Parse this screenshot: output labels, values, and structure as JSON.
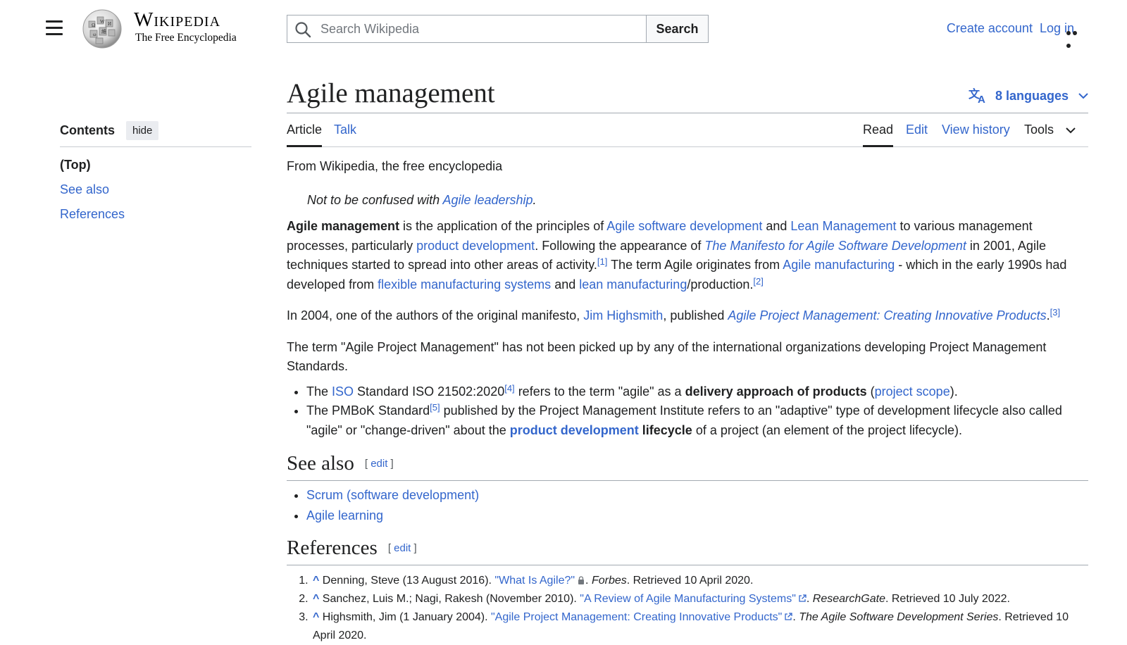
{
  "header": {
    "wordmark": "Wikipedia",
    "tagline": "The Free Encyclopedia",
    "search_placeholder": "Search Wikipedia",
    "search_button": "Search",
    "create_account": "Create account",
    "log_in": "Log in"
  },
  "toc": {
    "title": "Contents",
    "hide": "hide",
    "items": [
      "(Top)",
      "See also",
      "References"
    ]
  },
  "page": {
    "title": "Agile management",
    "languages": "8 languages",
    "tabs": {
      "article": "Article",
      "talk": "Talk",
      "read": "Read",
      "edit": "Edit",
      "view_history": "View history",
      "tools": "Tools"
    },
    "from": "From Wikipedia, the free encyclopedia",
    "hatnote": {
      "prefix": "Not to be confused with ",
      "link": "Agile leadership",
      "suffix": "."
    }
  },
  "body": {
    "p1": {
      "b1": "Agile management",
      "t1": " is the application of the principles of ",
      "l1": "Agile software development",
      "t2": " and ",
      "l2": "Lean Management",
      "t3": " to various management processes, particularly ",
      "l3": "product development",
      "t4": ". Following the appearance of ",
      "l4": "The Manifesto for Agile Software Development",
      "t5": " in 2001, Agile techniques started to spread into other areas of activity.",
      "r1": "[1]",
      "t6": " The term Agile originates from ",
      "l5": "Agile manufacturing",
      "t7": " - which in the early 1990s had developed from ",
      "l6": "flexible manufacturing systems",
      "t8": " and ",
      "l7": "lean manufacturing",
      "t9": "/production.",
      "r2": "[2]"
    },
    "p2": {
      "t1": "In 2004, one of the authors of the original manifesto, ",
      "l1": "Jim Highsmith",
      "t2": ", published ",
      "l2": "Agile Project Management: Creating Innovative Products",
      "t3": ".",
      "r3": "[3]"
    },
    "p3": "The term \"Agile Project Management\" has not been picked up by any of the international organizations developing Project Management Standards.",
    "li1": {
      "t1": "The ",
      "l1": "ISO",
      "t2": " Standard ISO 21502:2020",
      "r4": "[4]",
      "t3": " refers to the term \"agile\" as a ",
      "b1": "delivery approach of products",
      "t4": " (",
      "l2": "project scope",
      "t5": ")."
    },
    "li2": {
      "t1": "The PMBoK Standard",
      "r5": "[5]",
      "t2": " published by the Project Management Institute refers to an \"adaptive\" type of development lifecycle also called \"agile\" or \"change-driven\" about the ",
      "l1": "product development",
      "b1": " lifecycle",
      "t3": " of a project (an element of the project lifecycle)."
    }
  },
  "see_also": {
    "heading": "See also",
    "edit": "edit",
    "items": [
      "Scrum (software development)",
      "Agile learning"
    ]
  },
  "references": {
    "heading": "References",
    "edit": "edit",
    "caret": "^",
    "items": [
      {
        "pre": "Denning, Steve (13 August 2016). ",
        "link": "\"What Is Agile?\"",
        "pub": "Forbes",
        "post": ". Retrieved 10 April 2020."
      },
      {
        "pre": "Sanchez, Luis M.; Nagi, Rakesh (November 2010). ",
        "link": "\"A Review of Agile Manufacturing Systems\"",
        "pub": "ResearchGate",
        "post": ". Retrieved 10 July 2022."
      },
      {
        "pre": "Highsmith, Jim (1 January 2004). ",
        "link": "\"Agile Project Management: Creating Innovative Products\"",
        "pub": "The Agile Software Development Series",
        "post": ". Retrieved 10 April 2020."
      }
    ]
  }
}
